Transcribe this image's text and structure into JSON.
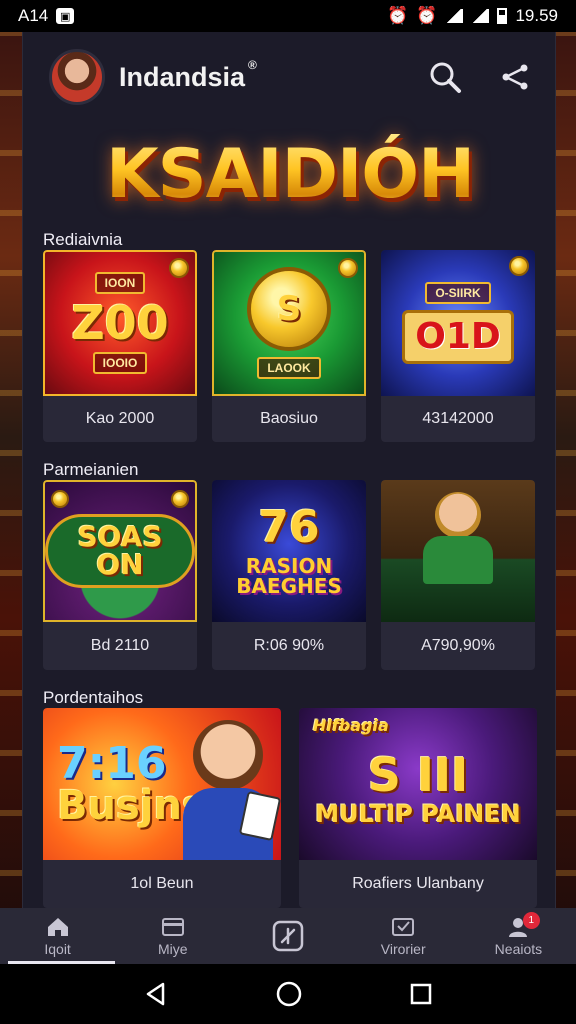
{
  "status_bar": {
    "time_left": "A14",
    "time_right": "19.59"
  },
  "header": {
    "app_name": "Indandsia",
    "reg_mark": "®"
  },
  "hero": {
    "title": "KSAIDIÓH"
  },
  "sections": [
    {
      "label": "Rediaivnia",
      "cards": [
        {
          "art_main": "Z00",
          "art_top": "IOON",
          "art_sub": "IOOIO",
          "caption": "Kao 2000",
          "theme": "red"
        },
        {
          "art_main": "S",
          "art_top": "",
          "art_sub": "LAOOK",
          "caption": "Baosiuo",
          "theme": "green"
        },
        {
          "art_main": "O1D",
          "art_top": "O-SIIRK",
          "art_sub": "",
          "caption": "43142000",
          "theme": "blue"
        }
      ]
    },
    {
      "label": "Parmeianien",
      "cards": [
        {
          "art_main": "SOAS ON",
          "art_top": "",
          "art_sub": "",
          "caption": "Bd 2110",
          "theme": "purple"
        },
        {
          "art_main": "76",
          "art_top": "",
          "art_sub": "RASION BAEGHES",
          "caption": "R:06 90%",
          "theme": "navy"
        },
        {
          "art_main": "",
          "art_top": "",
          "art_sub": "",
          "caption": "A790,90%",
          "theme": "brown"
        }
      ]
    },
    {
      "label": "Pordentaihos",
      "cards": [
        {
          "art_main": "7:16",
          "art_top": "",
          "art_sub": "Busjns",
          "caption": "1ol Beun",
          "theme": "orange"
        },
        {
          "art_main": "S III",
          "art_top": "Hlfbagia",
          "art_sub": "MULTIP PAINEN",
          "caption": "Roafiers Ulanbany",
          "theme": "violet"
        }
      ]
    }
  ],
  "bottom_nav": [
    {
      "label": "Iqoit",
      "icon": "home-icon"
    },
    {
      "label": "Miye",
      "icon": "card-icon"
    },
    {
      "label": "",
      "icon": "add-icon"
    },
    {
      "label": "Virorier",
      "icon": "mail-icon"
    },
    {
      "label": "Neaiots",
      "icon": "profile-icon",
      "badge": "1"
    }
  ],
  "colors": {
    "panel": "#1c1b29",
    "card": "#292838",
    "gold": "#ffcf3a",
    "badge": "#e0283a"
  }
}
